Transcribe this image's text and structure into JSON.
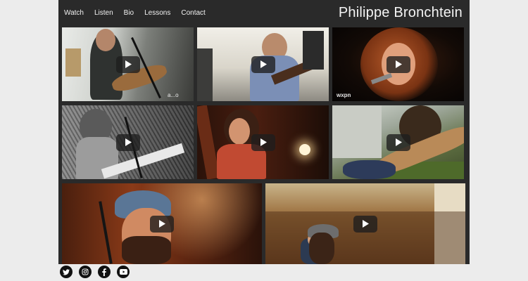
{
  "nav": {
    "items": [
      {
        "label": "Watch"
      },
      {
        "label": "Listen"
      },
      {
        "label": "Bio"
      },
      {
        "label": "Lessons"
      },
      {
        "label": "Contact"
      }
    ]
  },
  "brand": {
    "name": "Philippe Bronchtein"
  },
  "videos": {
    "watermark_1": "a...o",
    "watermark_3": "wxpn"
  },
  "footer": {
    "icons": [
      "twitter-icon",
      "instagram-icon",
      "facebook-icon",
      "youtube-icon"
    ]
  },
  "colors": {
    "page_bg": "#ececec",
    "site_bg": "#2a2a2a",
    "nav_text": "#f2f2f2",
    "play_button": "#1e1e1e",
    "social_bg": "#111111"
  }
}
